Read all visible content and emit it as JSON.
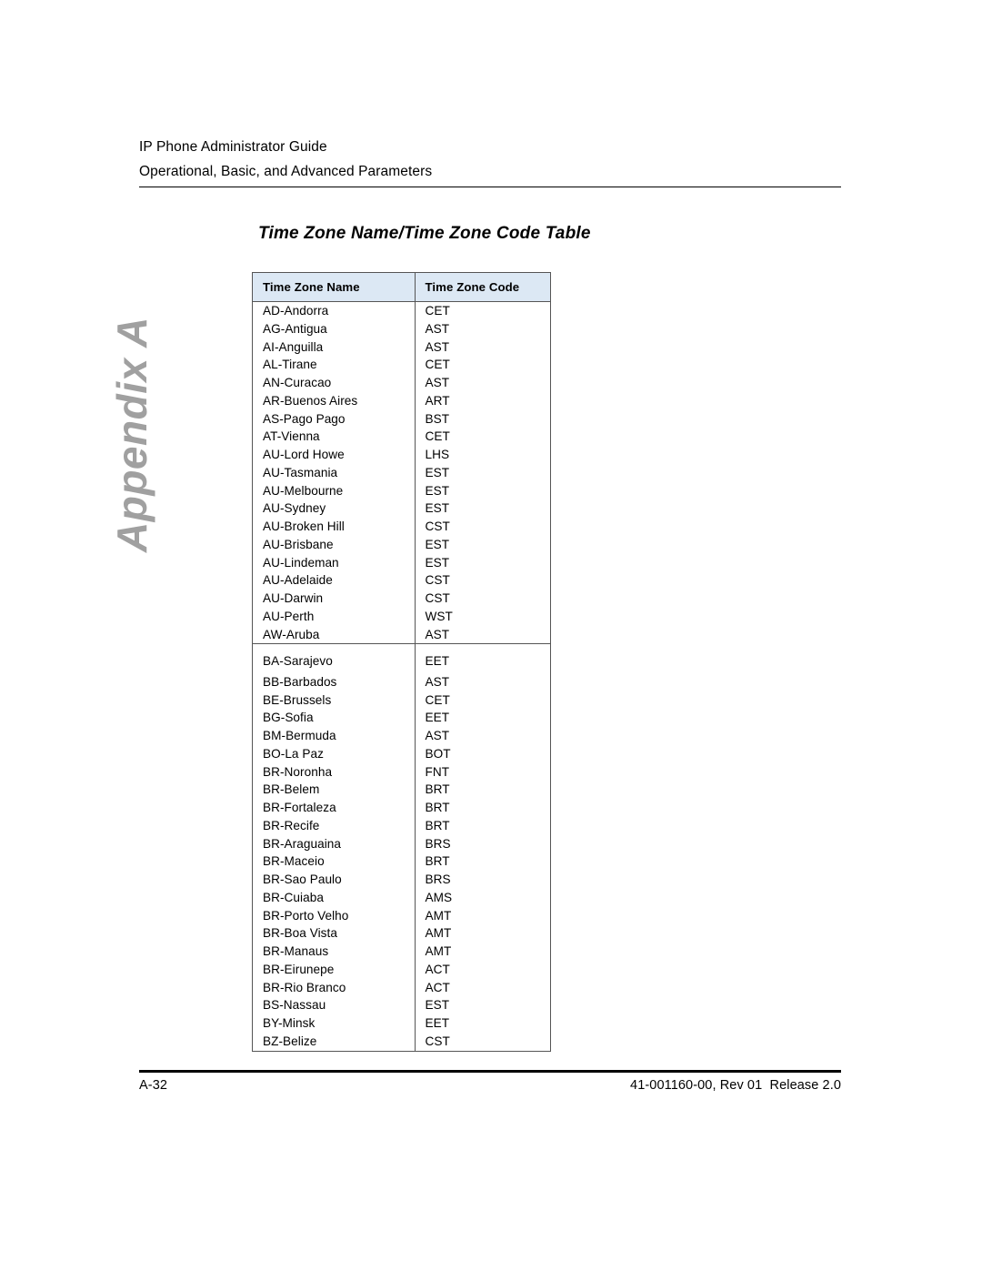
{
  "header": {
    "line1": "IP Phone Administrator Guide",
    "line2": "Operational, Basic, and Advanced Parameters"
  },
  "appendix_tab": {
    "label": "Appendix A",
    "color": "#a0a0a0"
  },
  "table_title": "Time Zone Name/Time Zone Code Table",
  "table": {
    "header_bg": "#dce8f4",
    "border_color": "#555555",
    "columns": [
      "Time Zone Name",
      "Time Zone Code"
    ],
    "groups": [
      {
        "letter": "A",
        "rows": [
          [
            "AD-Andorra",
            "CET"
          ],
          [
            "AG-Antigua",
            "AST"
          ],
          [
            "AI-Anguilla",
            "AST"
          ],
          [
            "AL-Tirane",
            "CET"
          ],
          [
            "AN-Curacao",
            "AST"
          ],
          [
            "AR-Buenos Aires",
            "ART"
          ],
          [
            "AS-Pago Pago",
            "BST"
          ],
          [
            "AT-Vienna",
            "CET"
          ],
          [
            "AU-Lord Howe",
            "LHS"
          ],
          [
            "AU-Tasmania",
            "EST"
          ],
          [
            "AU-Melbourne",
            "EST"
          ],
          [
            "AU-Sydney",
            "EST"
          ],
          [
            "AU-Broken Hill",
            "CST"
          ],
          [
            "AU-Brisbane",
            "EST"
          ],
          [
            "AU-Lindeman",
            "EST"
          ],
          [
            "AU-Adelaide",
            "CST"
          ],
          [
            "AU-Darwin",
            "CST"
          ],
          [
            "AU-Perth",
            "WST"
          ],
          [
            "AW-Aruba",
            "AST"
          ]
        ]
      },
      {
        "letter": "B",
        "rows": [
          [
            "BA-Sarajevo",
            "EET"
          ],
          [
            "BB-Barbados",
            "AST"
          ],
          [
            "BE-Brussels",
            "CET"
          ],
          [
            "BG-Sofia",
            "EET"
          ],
          [
            "BM-Bermuda",
            "AST"
          ],
          [
            "BO-La Paz",
            "BOT"
          ],
          [
            "BR-Noronha",
            "FNT"
          ],
          [
            "BR-Belem",
            "BRT"
          ],
          [
            "BR-Fortaleza",
            "BRT"
          ],
          [
            "BR-Recife",
            "BRT"
          ],
          [
            "BR-Araguaina",
            "BRS"
          ],
          [
            "BR-Maceio",
            "BRT"
          ],
          [
            "BR-Sao Paulo",
            "BRS"
          ],
          [
            "BR-Cuiaba",
            "AMS"
          ],
          [
            "BR-Porto Velho",
            "AMT"
          ],
          [
            "BR-Boa Vista",
            "AMT"
          ],
          [
            "BR-Manaus",
            "AMT"
          ],
          [
            "BR-Eirunepe",
            "ACT"
          ],
          [
            "BR-Rio Branco",
            "ACT"
          ],
          [
            "BS-Nassau",
            "EST"
          ],
          [
            "BY-Minsk",
            "EET"
          ],
          [
            "BZ-Belize",
            "CST"
          ]
        ]
      }
    ]
  },
  "footer": {
    "page_number": "A-32",
    "document_id": "41-001160-00, Rev 01  Release 2.0"
  }
}
